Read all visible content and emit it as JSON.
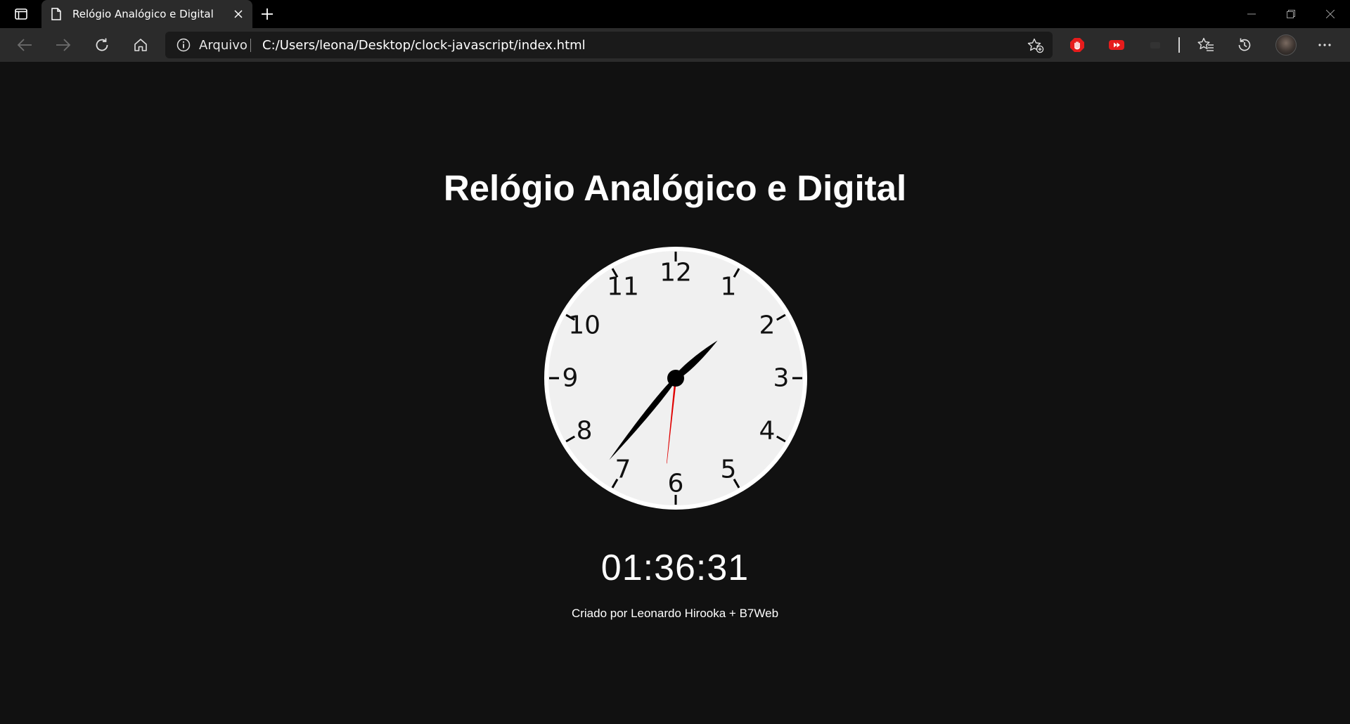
{
  "browser": {
    "tab": {
      "title": "Relógio Analógico e Digital"
    },
    "addressbar": {
      "scheme_label": "Arquivo",
      "url": "C:/Users/leona/Desktop/clock-javascript/index.html"
    }
  },
  "page": {
    "title": "Relógio Analógico e Digital",
    "digital_time": "01:36:31",
    "credits": "Criado por Leonardo Hirooka + B7Web"
  },
  "clock": {
    "numbers": [
      "12",
      "1",
      "2",
      "3",
      "4",
      "5",
      "6",
      "7",
      "8",
      "9",
      "10",
      "11"
    ],
    "hour": 1,
    "minute": 36,
    "second": 31,
    "face_color": "#f0f0f0",
    "rim_color": "#ffffff",
    "hand_color": "#000000",
    "second_hand_color": "#e00000"
  },
  "colors": {
    "page_background": "#111111",
    "tabstrip_background": "#000000",
    "toolbar_background": "#2b2b2b"
  }
}
